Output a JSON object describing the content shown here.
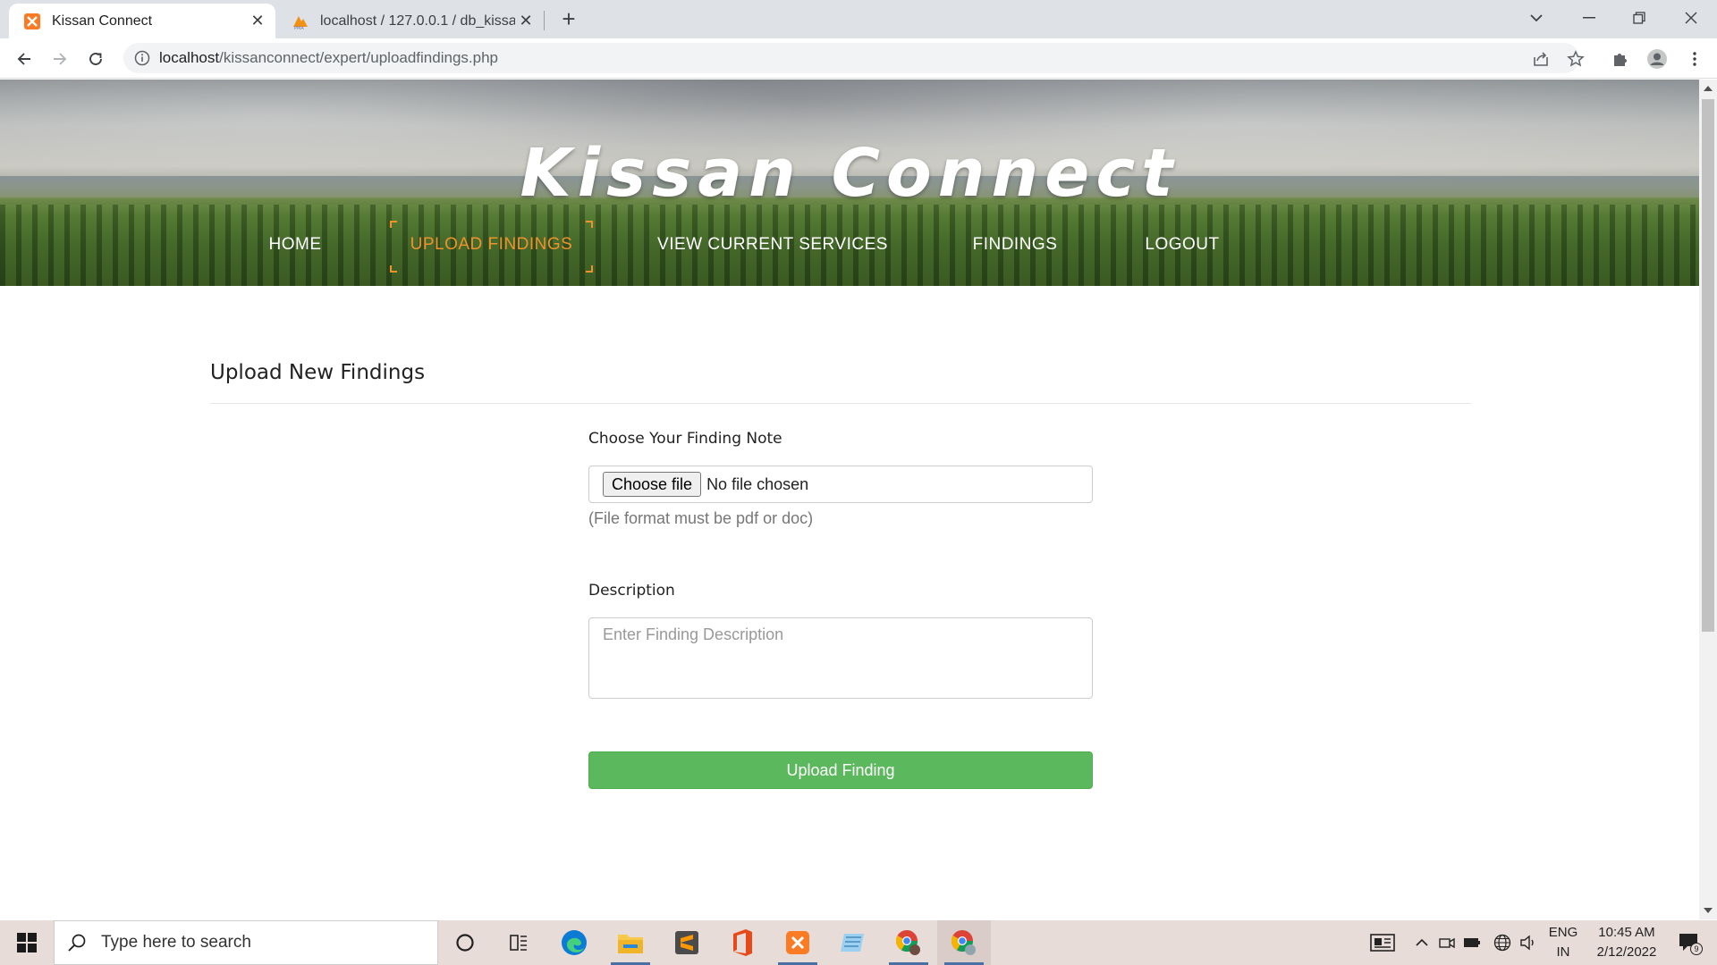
{
  "browser": {
    "tabs": [
      {
        "title": "Kissan Connect",
        "active": true
      },
      {
        "title": "localhost / 127.0.0.1 / db_kissanc",
        "active": false
      }
    ],
    "url_host": "localhost",
    "url_path": "/kissanconnect/expert/uploadfindings.php"
  },
  "header": {
    "site_title": "Kissan Connect",
    "nav": [
      {
        "label": "HOME",
        "active": false
      },
      {
        "label": "UPLOAD FINDINGS",
        "active": true
      },
      {
        "label": "VIEW CURRENT SERVICES",
        "active": false
      },
      {
        "label": "FINDINGS",
        "active": false
      },
      {
        "label": "LOGOUT",
        "active": false
      }
    ]
  },
  "main": {
    "heading": "Upload New Findings",
    "file_label": "Choose Your Finding Note",
    "file_button": "Choose file",
    "file_status": "No file chosen",
    "file_help": "(File format must be pdf or doc)",
    "description_label": "Description",
    "description_placeholder": "Enter Finding Description",
    "submit_label": "Upload Finding"
  },
  "taskbar": {
    "search_placeholder": "Type here to search",
    "language_top": "ENG",
    "language_bottom": "IN",
    "time": "10:45 AM",
    "date": "2/12/2022",
    "notification_count": "9"
  },
  "colors": {
    "accent_orange": "#f0922b",
    "button_green": "#5cb85c"
  }
}
